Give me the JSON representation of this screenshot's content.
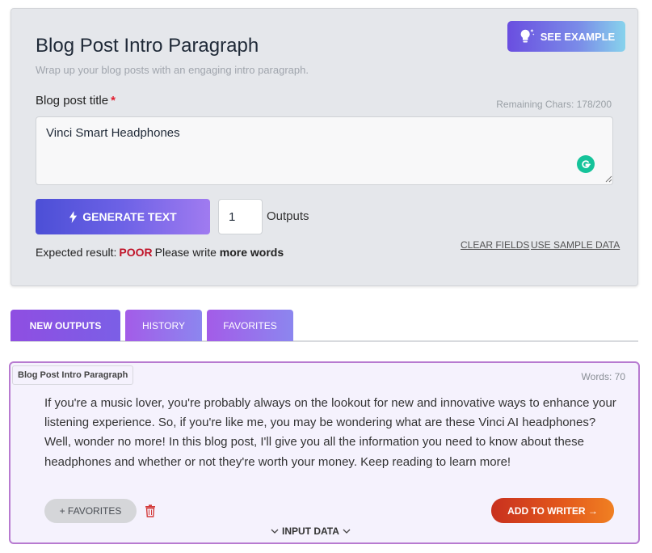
{
  "tool": {
    "title": "Blog Post Intro Paragraph",
    "subtitle": "Wrap up your blog posts with an engaging intro paragraph.",
    "see_example_label": "SEE EXAMPLE",
    "field_label": "Blog post title",
    "required_mark": "*",
    "remaining_chars": "Remaining Chars: 178/200",
    "title_value": "Vinci Smart Headphones",
    "generate_label": "GENERATE TEXT",
    "outputs_value": "1",
    "outputs_label": "Outputs",
    "expected_prefix": "Expected result:",
    "expected_rating": "POOR",
    "expected_hint_prefix": "Please write",
    "expected_hint_bold": "more words",
    "clear_fields": "CLEAR FIELDS",
    "use_sample": "USE SAMPLE DATA"
  },
  "tabs": [
    {
      "label": "NEW OUTPUTS",
      "active": true
    },
    {
      "label": "HISTORY",
      "active": false
    },
    {
      "label": "FAVORITES",
      "active": false
    }
  ],
  "output": {
    "tag": "Blog Post Intro Paragraph",
    "word_count": "Words: 70",
    "text": "If you're a music lover, you're probably always on the lookout for new and innovative ways to enhance your listening experience. So, if you're like me, you may be wondering what are these Vinci AI headphones? Well, wonder no more! In this blog post, I'll give you all the information you need to know about these headphones and whether or not they're worth your money. Keep reading to learn more!",
    "favorites_label": "+ FAVORITES",
    "add_to_writer_label": "ADD TO WRITER →",
    "input_data_label": "INPUT DATA"
  },
  "colors": {
    "poor": "#c0152a",
    "required": "#e11d2e",
    "grammarly": "#15c39a",
    "output_border": "#b77ad0"
  }
}
